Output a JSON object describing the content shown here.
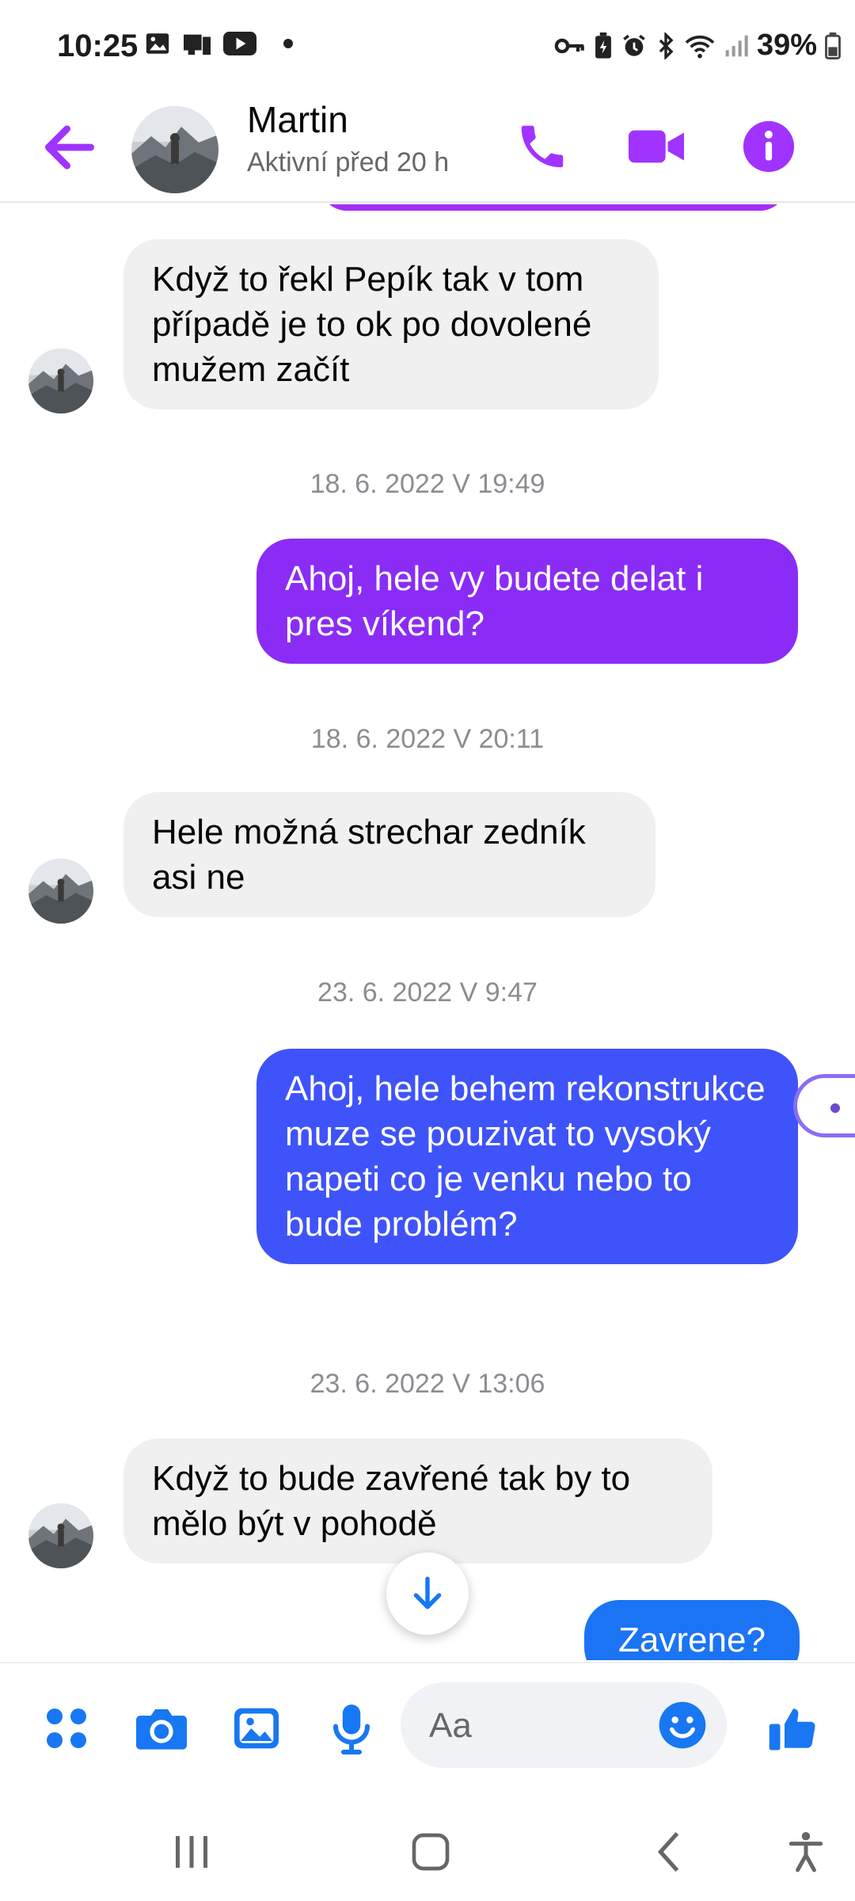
{
  "status_bar": {
    "time": "10:25",
    "battery": "39%"
  },
  "header": {
    "name": "Martin",
    "status": "Aktivní před 20 h"
  },
  "messages": [
    {
      "text": "Když to řekl Pepík tak v tom případě je to ok po dovolené mužem začít"
    },
    {
      "timestamp": "18. 6. 2022 V 19:49"
    },
    {
      "text": "Ahoj, hele vy budete delat i pres víkend?"
    },
    {
      "timestamp": "18. 6. 2022 V 20:11"
    },
    {
      "text": "Hele možná strechar zedník asi ne"
    },
    {
      "timestamp": "23. 6. 2022 V 9:47"
    },
    {
      "text": "Ahoj, hele behem rekonstrukce muze se pouzivat to vysoký napeti co je venku nebo to bude problém?"
    },
    {
      "timestamp": "23. 6. 2022 V 13:06"
    },
    {
      "text": "Když to bude zavřené tak by to mělo být v pohodě"
    },
    {
      "text": "Zavrene?"
    }
  ],
  "composer": {
    "placeholder": "Aa"
  },
  "colors": {
    "accent": "#a033ff",
    "messenger_blue": "#0084ff",
    "bubble_in": "#f0f0f0"
  },
  "icons": [
    "arrow-back-icon",
    "phone-icon",
    "video-icon",
    "info-icon",
    "apps-icon",
    "camera-icon",
    "gallery-icon",
    "mic-icon",
    "emoji-icon",
    "thumbs-up-icon",
    "arrow-down-icon"
  ]
}
